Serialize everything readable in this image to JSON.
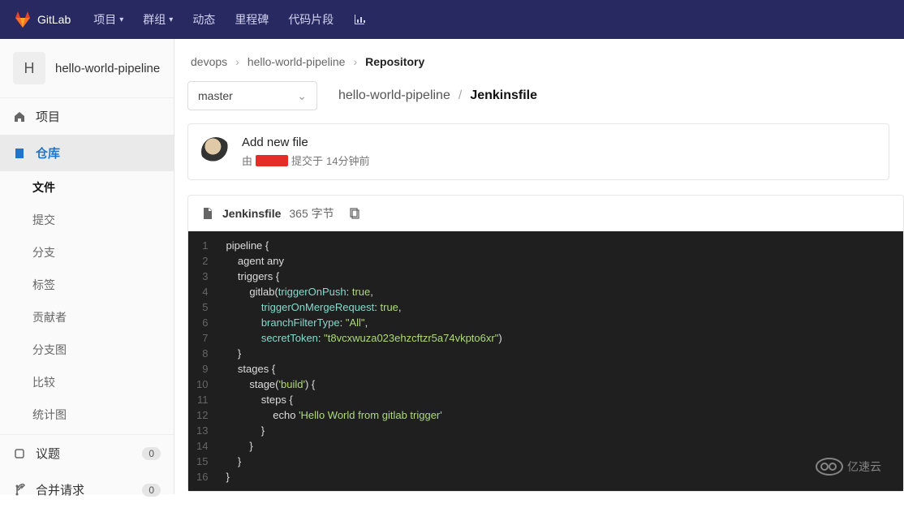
{
  "topbar": {
    "brand": "GitLab",
    "nav": [
      {
        "label": "项目",
        "hasDropdown": true
      },
      {
        "label": "群组",
        "hasDropdown": true
      },
      {
        "label": "动态"
      },
      {
        "label": "里程碑"
      },
      {
        "label": "代码片段"
      }
    ]
  },
  "project": {
    "avatarLetter": "H",
    "name": "hello-world-pipeline"
  },
  "sidebar": {
    "top": [
      {
        "icon": "home-icon",
        "label": "项目"
      },
      {
        "icon": "repo-icon",
        "label": "仓库",
        "active": true
      }
    ],
    "sub": [
      {
        "label": "文件",
        "active": true
      },
      {
        "label": "提交"
      },
      {
        "label": "分支"
      },
      {
        "label": "标签"
      },
      {
        "label": "贡献者"
      },
      {
        "label": "分支图"
      },
      {
        "label": "比较"
      },
      {
        "label": "统计图"
      }
    ],
    "lower": [
      {
        "icon": "issues-icon",
        "label": "议题",
        "badge": "0"
      },
      {
        "icon": "merge-icon",
        "label": "合并请求",
        "badge": "0"
      }
    ]
  },
  "breadcrumbs": {
    "a": "devops",
    "b": "hello-world-pipeline",
    "c": "Repository"
  },
  "branch": "master",
  "path": {
    "root": "hello-world-pipeline",
    "file": "Jenkinsfile"
  },
  "commit": {
    "title": "Add new file",
    "prefix": "由",
    "submitText": "提交于",
    "time": "14分钟前"
  },
  "file": {
    "name": "Jenkinsfile",
    "size": "365 字节",
    "lines": [
      [
        [
          "pl",
          "pipeline {",
          ""
        ]
      ],
      [
        [
          "pl",
          "    agent any"
        ]
      ],
      [
        [
          "pl",
          "    triggers {"
        ]
      ],
      [
        [
          "pl",
          "        gitlab("
        ],
        [
          "key",
          "triggerOnPush"
        ],
        [
          "pl",
          ": "
        ],
        [
          "kw",
          "true"
        ],
        [
          "pl",
          ","
        ]
      ],
      [
        [
          "pl",
          "            "
        ],
        [
          "key",
          "triggerOnMergeRequest"
        ],
        [
          "pl",
          ": "
        ],
        [
          "kw",
          "true"
        ],
        [
          "pl",
          ","
        ]
      ],
      [
        [
          "pl",
          "            "
        ],
        [
          "key",
          "branchFilterType"
        ],
        [
          "pl",
          ": "
        ],
        [
          "str",
          "\"All\""
        ],
        [
          "pl",
          ","
        ]
      ],
      [
        [
          "pl",
          "            "
        ],
        [
          "key",
          "secretToken"
        ],
        [
          "pl",
          ": "
        ],
        [
          "str",
          "\"t8vcxwuza023ehzcftzr5a74vkpto6xr\""
        ],
        [
          "pl",
          ")"
        ]
      ],
      [
        [
          "pl",
          "    }"
        ]
      ],
      [
        [
          "pl",
          "    stages {"
        ]
      ],
      [
        [
          "pl",
          "        stage("
        ],
        [
          "str",
          "'build'"
        ],
        [
          "pl",
          ") {"
        ]
      ],
      [
        [
          "pl",
          "            steps {"
        ]
      ],
      [
        [
          "pl",
          "                echo "
        ],
        [
          "str",
          "'Hello World from gitlab trigger'"
        ]
      ],
      [
        [
          "pl",
          "            }"
        ]
      ],
      [
        [
          "pl",
          "        }"
        ]
      ],
      [
        [
          "pl",
          "    }"
        ]
      ],
      [
        [
          "pl",
          "}"
        ]
      ]
    ]
  },
  "watermark": "亿速云"
}
